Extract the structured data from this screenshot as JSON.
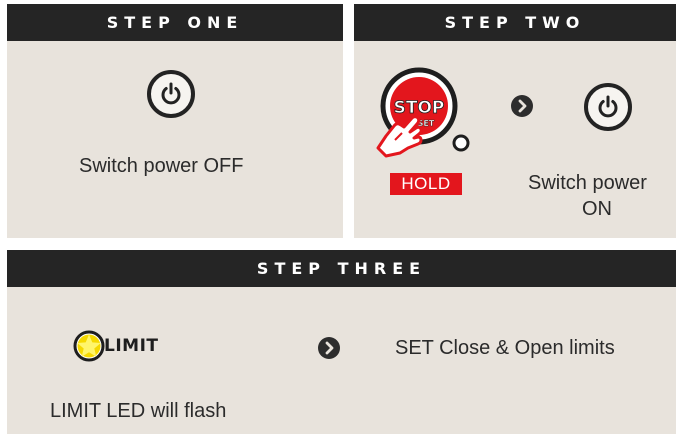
{
  "steps": {
    "one": {
      "title": "STEP ONE",
      "instruction": "Switch power OFF",
      "icon": "power-icon"
    },
    "two": {
      "title": "STEP TWO",
      "button_top_text": "STOP",
      "button_bottom_text": "SET",
      "hold_label": "HOLD",
      "instruction_line1": "Switch power",
      "instruction_line2": "ON",
      "icons": [
        "stop-set-button-icon",
        "hand-pointer-icon",
        "chevron-right-icon",
        "power-icon"
      ]
    },
    "three": {
      "title": "STEP THREE",
      "led_label": "LIMIT",
      "led_note": "LIMIT LED will flash",
      "instruction": "SET Close & Open limits",
      "icons": [
        "limit-led-icon",
        "chevron-right-icon"
      ]
    }
  },
  "colors": {
    "panel_bg": "#e8e3dc",
    "header_bg": "#252525",
    "accent_red": "#e3161d",
    "led_yellow": "#f5d800"
  }
}
